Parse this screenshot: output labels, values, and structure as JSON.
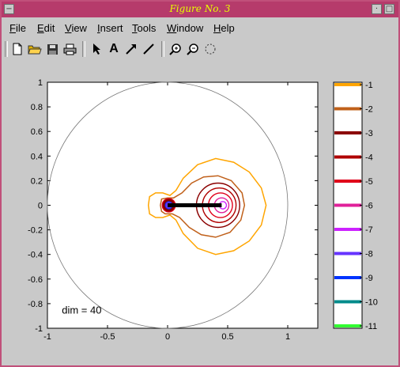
{
  "window": {
    "title": "Figure No. 3"
  },
  "menu": [
    {
      "mnemonic": "F",
      "rest": "ile"
    },
    {
      "mnemonic": "E",
      "rest": "dit"
    },
    {
      "mnemonic": "V",
      "rest": "iew"
    },
    {
      "mnemonic": "I",
      "rest": "nsert"
    },
    {
      "mnemonic": "T",
      "rest": "ools"
    },
    {
      "mnemonic": "W",
      "rest": "indow"
    },
    {
      "mnemonic": "H",
      "rest": "elp"
    }
  ],
  "toolbar": {
    "icons": [
      "new-file-icon",
      "open-folder-icon",
      "save-icon",
      "print-icon",
      "select-arrow-icon",
      "text-icon",
      "arrow-icon",
      "line-icon",
      "zoom-in-icon",
      "zoom-out-icon",
      "rotate-icon"
    ],
    "text_tool_label": "A"
  },
  "chart_data": {
    "type": "contour",
    "annotation": "dim = 40",
    "xlim": [
      -1,
      1.25
    ],
    "ylim": [
      -1,
      1
    ],
    "x_ticks": [
      "-1",
      "-0.5",
      "0",
      "0.5",
      "1"
    ],
    "y_ticks": [
      "1",
      "0.8",
      "0.6",
      "0.4",
      "0.2",
      "0",
      "-0.2",
      "-0.4",
      "-0.6",
      "-0.8",
      "-1"
    ],
    "unit_circle": true,
    "segment": {
      "from": [
        0,
        0
      ],
      "to": [
        0.45,
        0
      ],
      "color": "#000000"
    },
    "levels": [
      {
        "label": "-1",
        "color": "#ffa500"
      },
      {
        "label": "-2",
        "color": "#c0601a"
      },
      {
        "label": "-3",
        "color": "#8b0000"
      },
      {
        "label": "-4",
        "color": "#b00000"
      },
      {
        "label": "-5",
        "color": "#e0001a"
      },
      {
        "label": "-6",
        "color": "#e0209a"
      },
      {
        "label": "-7",
        "color": "#cc22ff"
      },
      {
        "label": "-8",
        "color": "#6633ff"
      },
      {
        "label": "-9",
        "color": "#0033ff"
      },
      {
        "label": "-10",
        "color": "#008b8b"
      },
      {
        "label": "-11",
        "color": "#33ff33"
      }
    ]
  }
}
